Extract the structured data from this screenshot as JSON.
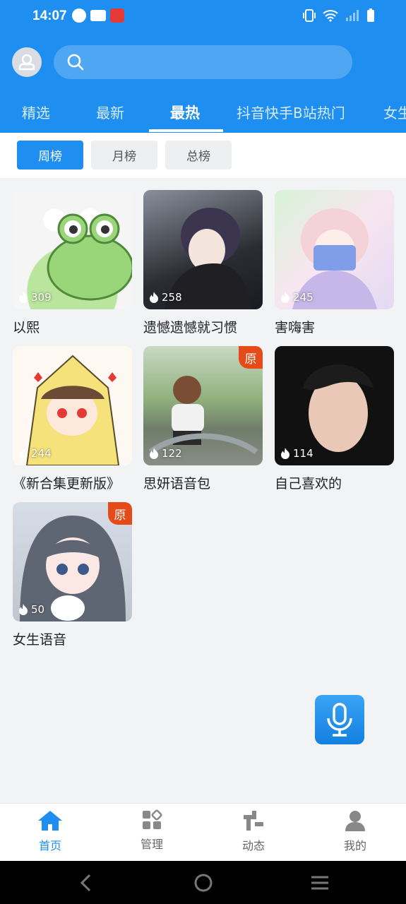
{
  "status": {
    "time": "14:07"
  },
  "search": {
    "placeholder": ""
  },
  "tabs": [
    {
      "label": "精选"
    },
    {
      "label": "最新"
    },
    {
      "label": "最热"
    },
    {
      "label": "抖音快手B站热门"
    },
    {
      "label": "女生"
    }
  ],
  "segments": [
    {
      "label": "周榜"
    },
    {
      "label": "月榜"
    },
    {
      "label": "总榜"
    }
  ],
  "cards": [
    {
      "title": "以熙",
      "count": "309",
      "badge": ""
    },
    {
      "title": "遗憾遗憾就习惯",
      "count": "258",
      "badge": ""
    },
    {
      "title": "害嗨害",
      "count": "245",
      "badge": ""
    },
    {
      "title": "《新合集更新版》",
      "count": "244",
      "badge": ""
    },
    {
      "title": "思妍语音包",
      "count": "122",
      "badge": "原"
    },
    {
      "title": "自己喜欢的",
      "count": "114",
      "badge": ""
    },
    {
      "title": "女生语音",
      "count": "50",
      "badge": "原"
    }
  ],
  "nav": [
    {
      "label": "首页"
    },
    {
      "label": "管理"
    },
    {
      "label": "动态"
    },
    {
      "label": "我的"
    }
  ],
  "colors": {
    "primary": "#1e8ff0",
    "badge": "#e64a19"
  }
}
